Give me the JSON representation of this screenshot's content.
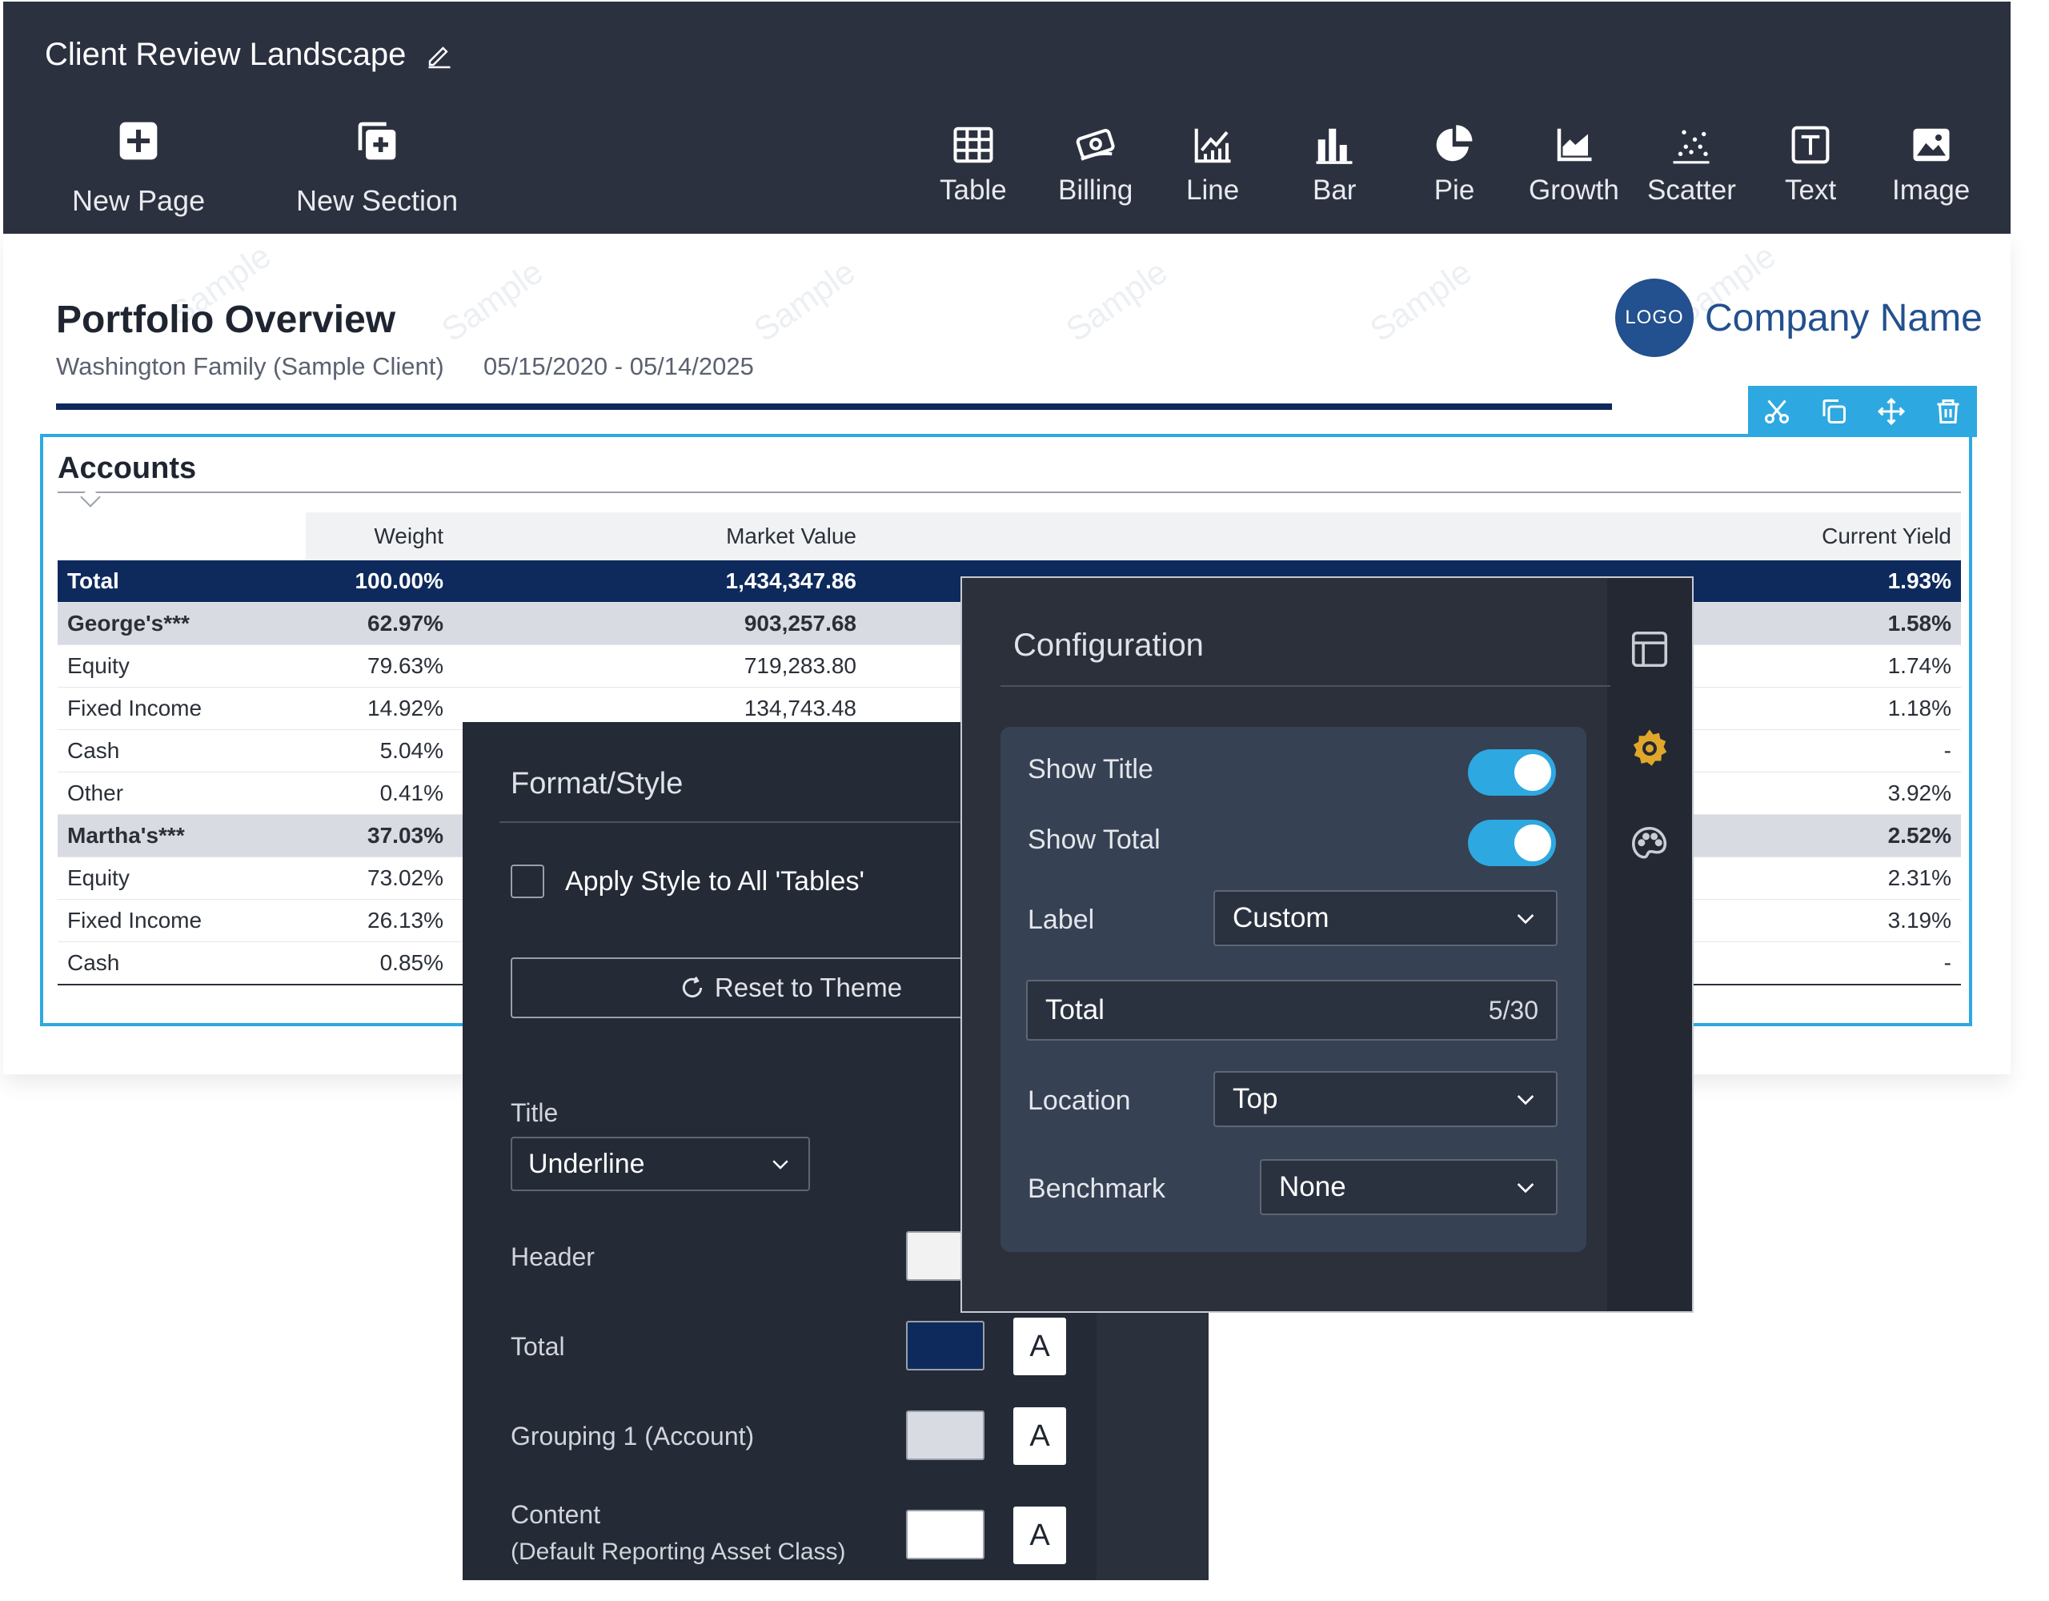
{
  "toolbar": {
    "title": "Client Review Landscape",
    "left_tools": [
      {
        "label": "New Page",
        "icon": "plus-square-icon"
      },
      {
        "label": "New Section",
        "icon": "add-section-icon"
      }
    ],
    "tools": [
      {
        "label": "Table",
        "icon": "table-icon"
      },
      {
        "label": "Billing",
        "icon": "billing-icon"
      },
      {
        "label": "Line",
        "icon": "line-chart-icon"
      },
      {
        "label": "Bar",
        "icon": "bar-chart-icon"
      },
      {
        "label": "Pie",
        "icon": "pie-chart-icon"
      },
      {
        "label": "Growth",
        "icon": "growth-chart-icon"
      },
      {
        "label": "Scatter",
        "icon": "scatter-chart-icon"
      },
      {
        "label": "Text",
        "icon": "text-icon"
      },
      {
        "label": "Image",
        "icon": "image-icon"
      }
    ]
  },
  "report": {
    "title": "Portfolio Overview",
    "client": "Washington Family (Sample Client)",
    "date_range": "05/15/2020 - 05/14/2025",
    "logo_text": "LOGO",
    "company_name": "Company Name",
    "watermark": "Sample"
  },
  "accounts": {
    "title": "Accounts",
    "columns": [
      "",
      "Weight",
      "Market Value",
      "Current Yield"
    ],
    "rows": [
      {
        "type": "total",
        "name": "Total",
        "weight": "100.00%",
        "market_value": "1,434,347.86",
        "yield": "1.93%"
      },
      {
        "type": "group",
        "name": "George's***",
        "weight": "62.97%",
        "market_value": "903,257.68",
        "yield": "1.58%"
      },
      {
        "type": "content",
        "name": "Equity",
        "weight": "79.63%",
        "market_value": "719,283.80",
        "yield": "1.74%"
      },
      {
        "type": "content",
        "name": "Fixed Income",
        "weight": "14.92%",
        "market_value": "134,743.48",
        "yield": "1.18%"
      },
      {
        "type": "content",
        "name": "Cash",
        "weight": "5.04%",
        "market_value": "",
        "yield": "-"
      },
      {
        "type": "content",
        "name": "Other",
        "weight": "0.41%",
        "market_value": "",
        "yield": "3.92%"
      },
      {
        "type": "group",
        "name": "Martha's***",
        "weight": "37.03%",
        "market_value": "",
        "yield": "2.52%"
      },
      {
        "type": "content",
        "name": "Equity",
        "weight": "73.02%",
        "market_value": "",
        "yield": "2.31%"
      },
      {
        "type": "content",
        "name": "Fixed Income",
        "weight": "26.13%",
        "market_value": "",
        "yield": "3.19%"
      },
      {
        "type": "content",
        "name": "Cash",
        "weight": "0.85%",
        "market_value": "",
        "yield": "-"
      }
    ]
  },
  "format_panel": {
    "title": "Format/Style",
    "apply_all_label": "Apply Style to All 'Tables'",
    "reset_label": "Reset to Theme",
    "title_label": "Title",
    "title_style_value": "Underline",
    "rows": [
      {
        "label": "Header",
        "swatch": "#f2f2f2",
        "has_font_button": false
      },
      {
        "label": "Total",
        "swatch": "#0e2a5c",
        "has_font_button": true
      },
      {
        "label": "Grouping 1 (Account)",
        "swatch": "#d9dbe3",
        "has_font_button": true
      },
      {
        "label": "Content",
        "sublabel": "(Default Reporting Asset Class)",
        "swatch": "#ffffff",
        "has_font_button": true
      }
    ],
    "font_button_label": "A"
  },
  "config_panel": {
    "title": "Configuration",
    "show_title_label": "Show Title",
    "show_title_on": true,
    "show_total_label": "Show Total",
    "show_total_on": true,
    "label_label": "Label",
    "label_value": "Custom",
    "total_input_value": "Total",
    "total_input_count": "5/30",
    "location_label": "Location",
    "location_value": "Top",
    "benchmark_label": "Benchmark",
    "benchmark_value": "None"
  },
  "colors": {
    "toolbar_bg": "#2c3140",
    "accent": "#2ea8e0",
    "navy": "#0e2a5c",
    "brand": "#23508e",
    "gear_active": "#e0a72a"
  }
}
